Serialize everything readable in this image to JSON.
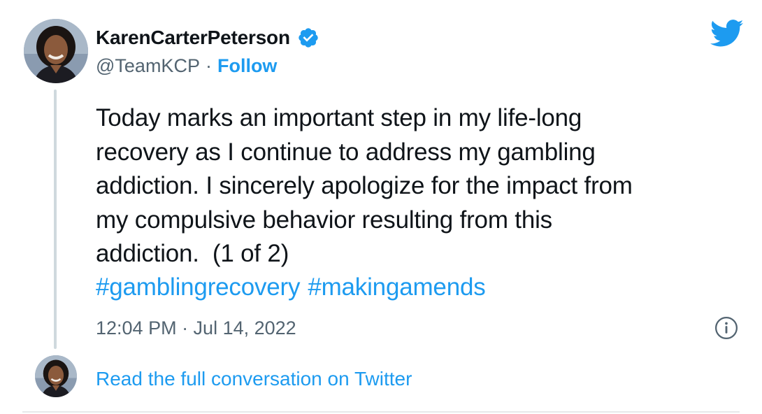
{
  "tweet": {
    "author": {
      "display_name": "KarenCarterPeterson",
      "handle": "@TeamKCP",
      "separator": "·",
      "follow_label": "Follow",
      "verified": true
    },
    "text_lines": [
      "Today marks an important step in my life-long",
      "recovery as I continue to address my gambling",
      "addiction. I sincerely apologize for the impact from",
      "my compulsive behavior resulting from this",
      "addiction.  (1 of 2)"
    ],
    "hashtags": [
      "#gamblingrecovery",
      "#makingamends"
    ],
    "timestamp": "12:04 PM · Jul 14, 2022"
  },
  "footer": {
    "read_more_label": "Read the full conversation on Twitter"
  },
  "icons": {
    "brand": "twitter-bird-icon",
    "verified": "verified-badge-icon",
    "info": "info-icon"
  },
  "colors": {
    "accent": "#1d9bf0",
    "text_primary": "#0f1419",
    "text_secondary": "#536471",
    "thread_line": "#cfd9de"
  }
}
